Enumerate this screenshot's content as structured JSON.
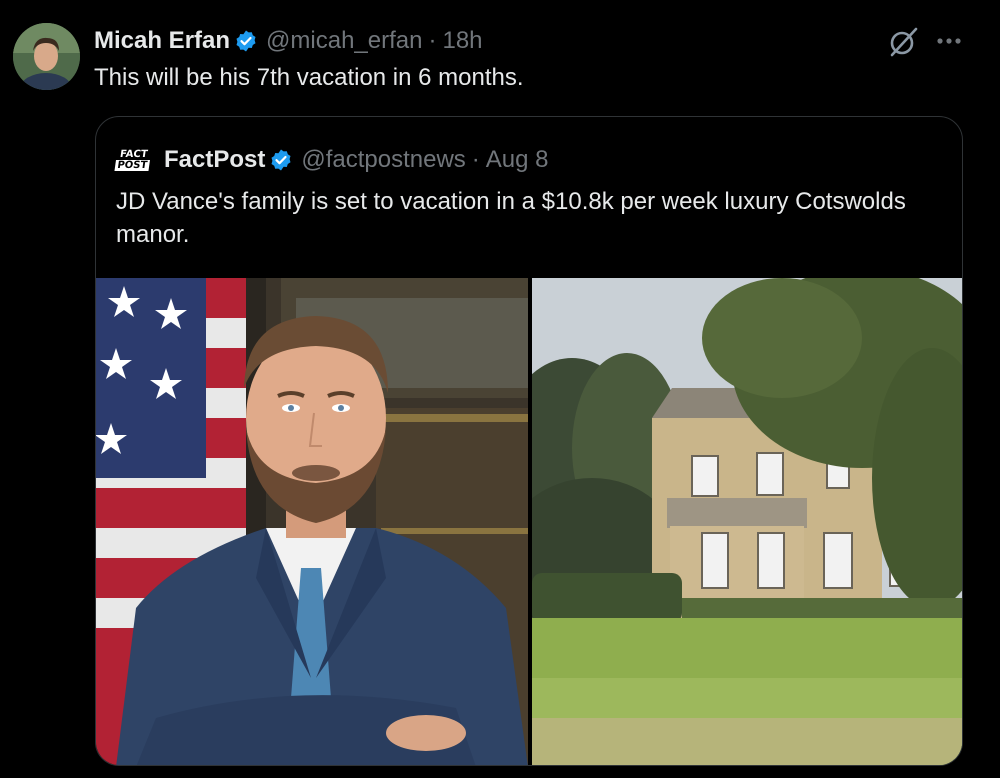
{
  "tweet": {
    "author_name": "Micah Erfan",
    "author_handle": "@micah_erfan",
    "separator": "·",
    "time": "18h",
    "text": "This will be his 7th vacation in 6 months.",
    "more_icon": "more-horizontal-icon",
    "grok_icon": "grok-icon"
  },
  "quote": {
    "logo_top": "FACT",
    "logo_bottom": "POST",
    "author_name": "FactPost",
    "author_handle": "@factpostnews",
    "separator": "·",
    "time": "Aug 8",
    "text": "JD Vance's family is set to vacation in a $10.8k per week luxury Cotswolds manor."
  },
  "colors": {
    "background": "#000000",
    "text": "#e7e9ea",
    "muted": "#71767b",
    "verified": "#1d9bf0",
    "border": "#2f3336"
  }
}
